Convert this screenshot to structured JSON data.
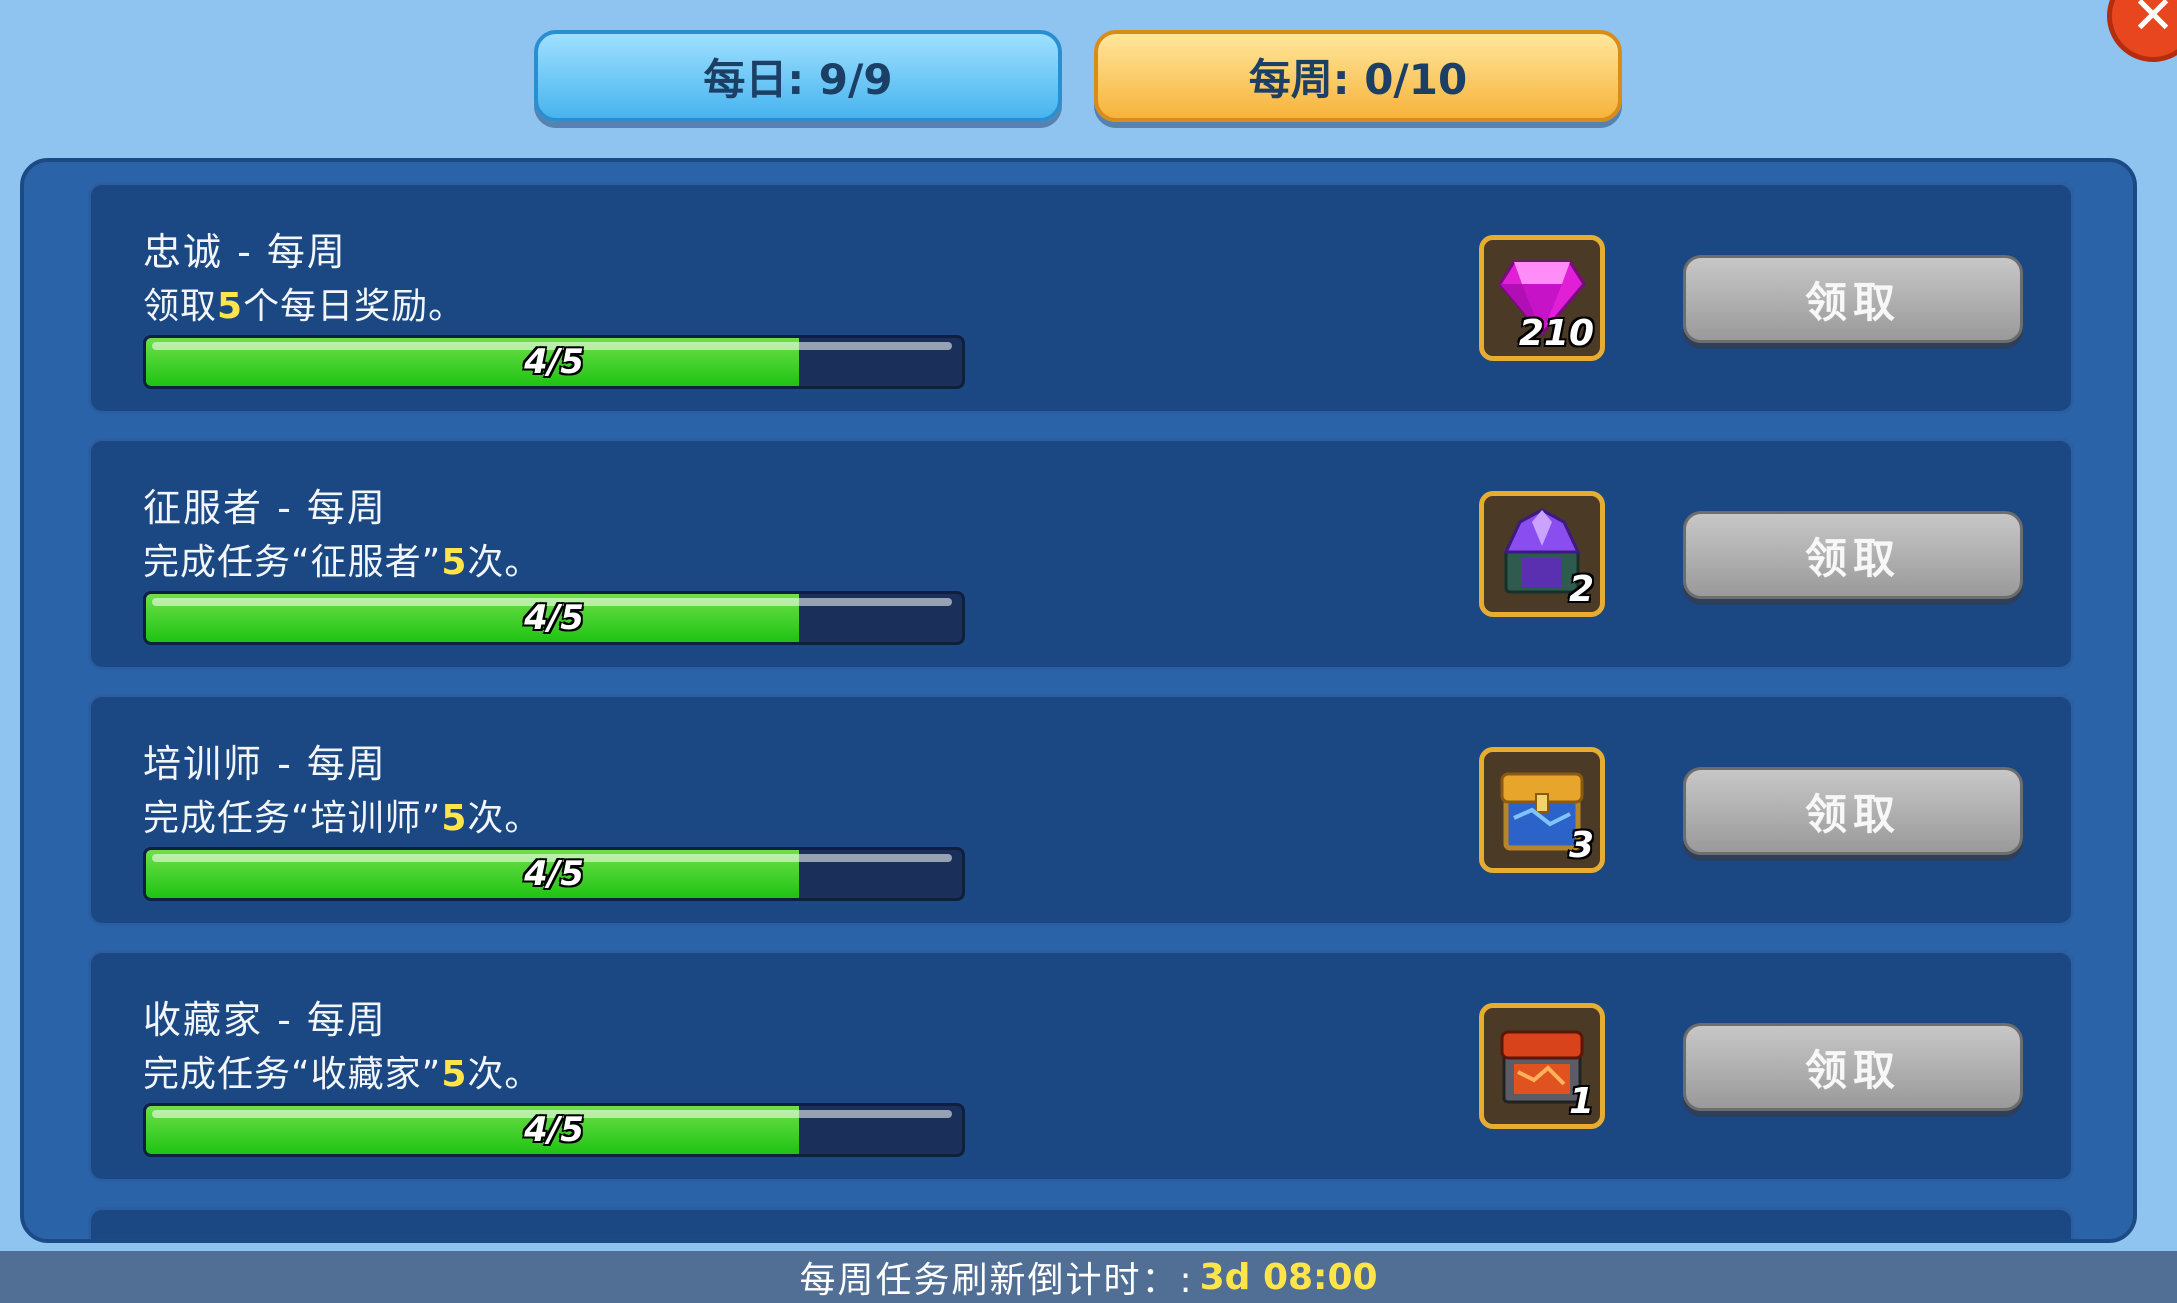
{
  "tabs": {
    "daily": "每日: 9/9",
    "weekly": "每周: 0/10"
  },
  "quests": [
    {
      "title": "忠诚 - 每周",
      "desc_pre": "领取",
      "desc_num": "5",
      "desc_post": "个每日奖励。",
      "progress_text": "4/5",
      "progress": 0.8,
      "reward_icon": "gem-icon",
      "reward_count": "210",
      "button": "领取"
    },
    {
      "title": "征服者 - 每周",
      "desc_pre": "完成任务“征服者”",
      "desc_num": "5",
      "desc_post": "次。",
      "progress_text": "4/5",
      "progress": 0.8,
      "reward_icon": "purple-crystal-chest-icon",
      "reward_count": "2",
      "button": "领取"
    },
    {
      "title": "培训师 - 每周",
      "desc_pre": "完成任务“培训师”",
      "desc_num": "5",
      "desc_post": "次。",
      "progress_text": "4/5",
      "progress": 0.8,
      "reward_icon": "blue-gold-chest-icon",
      "reward_count": "3",
      "button": "领取"
    },
    {
      "title": "收藏家 - 每周",
      "desc_pre": "完成任务“收藏家”",
      "desc_num": "5",
      "desc_post": "次。",
      "progress_text": "4/5",
      "progress": 0.8,
      "reward_icon": "red-lava-chest-icon",
      "reward_count": "1",
      "button": "领取"
    }
  ],
  "footer": {
    "label": "每周任务刷新倒计时：:",
    "timer": "3d 08:00"
  },
  "colors": {
    "progress_green": "#1fc313",
    "highlight_yellow": "#ffe54a",
    "panel_blue": "#2b63a8"
  }
}
